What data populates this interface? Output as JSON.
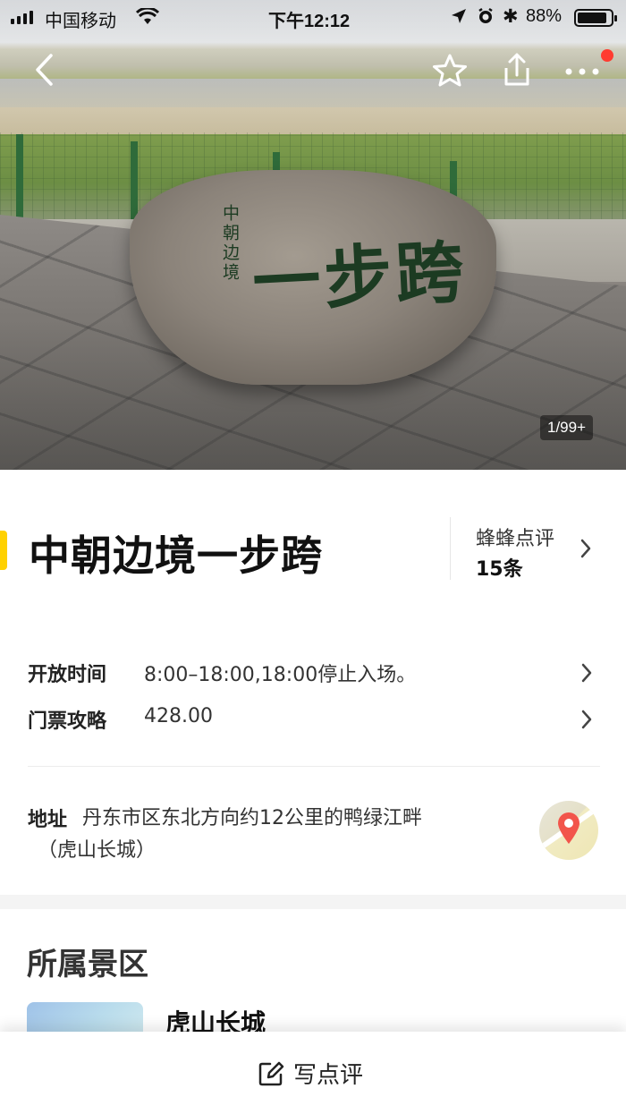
{
  "status_bar": {
    "carrier": "中国移动",
    "time": "下午12:12",
    "battery_percent": "88%",
    "battery_level": 0.88
  },
  "hero": {
    "rock_text_main": "一步跨",
    "rock_text_side": "中朝边境",
    "photo_counter": "1/99+"
  },
  "nav": {
    "icons": [
      "back-icon",
      "star-icon",
      "share-icon",
      "more-icon"
    ],
    "has_notification_dot": true
  },
  "poi": {
    "title": "中朝边境一步跨",
    "reviews_label": "蜂蜂点评",
    "reviews_count": "15条"
  },
  "info": {
    "hours_label": "开放时间",
    "hours_value": "8:00–18:00,18:00停止入场。",
    "ticket_label": "门票攻略",
    "ticket_value": "428.00",
    "address_label": "地址",
    "address_line1": "丹东市区东北方向约12公里的鸭绿江畔",
    "address_line2": "（虎山长城）"
  },
  "scenic": {
    "section_title": "所属景区",
    "spot_name": "虎山长城"
  },
  "bottom_bar": {
    "write_review_label": "写点评"
  },
  "colors": {
    "accent_yellow": "#ffd100",
    "notification_red": "#ff3b30",
    "map_pin_red": "#f2554b"
  }
}
